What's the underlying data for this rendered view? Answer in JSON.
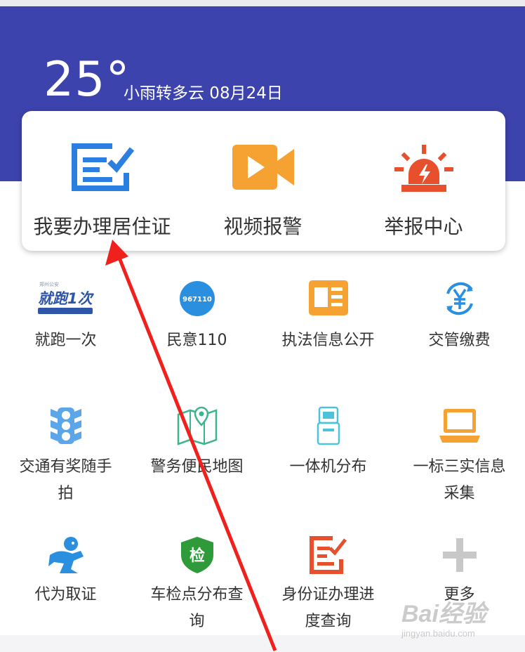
{
  "header": {
    "temperature": "25°",
    "weather": "小雨转多云 08月24日",
    "bg_color": "#3d43ad"
  },
  "quick_actions": [
    {
      "label": "我要办理居住证",
      "icon": "id-form-icon"
    },
    {
      "label": "视频报警",
      "icon": "video-camera-icon"
    },
    {
      "label": "举报中心",
      "icon": "alarm-siren-icon"
    }
  ],
  "services": [
    {
      "label": "就跑一次",
      "icon": "jiupao-logo-icon",
      "icon_text": "就跑1次"
    },
    {
      "label": "民意110",
      "icon": "hotline-icon",
      "icon_text": "967110"
    },
    {
      "label": "执法信息公开",
      "icon": "info-card-icon"
    },
    {
      "label": "交管缴费",
      "icon": "yuan-payment-icon"
    },
    {
      "label": "交通有奖随手拍",
      "icon": "traffic-light-icon"
    },
    {
      "label": "警务便民地图",
      "icon": "map-pin-icon"
    },
    {
      "label": "一体机分布",
      "icon": "kiosk-icon"
    },
    {
      "label": "一标三实信息采集",
      "icon": "laptop-icon"
    },
    {
      "label": "代为取证",
      "icon": "runner-icon"
    },
    {
      "label": "车检点分布查询",
      "icon": "inspection-shield-icon",
      "icon_text": "检"
    },
    {
      "label": "身份证办理进度查询",
      "icon": "id-progress-icon"
    },
    {
      "label": "更多",
      "icon": "plus-icon"
    }
  ],
  "watermark": {
    "main": "Bai经验",
    "sub": "jingyan.baidu.com"
  },
  "colors": {
    "blue": "#2b7fe0",
    "orange": "#f5a233",
    "red": "#e8502d",
    "green": "#2e9a3a",
    "arrow": "#f0201c"
  }
}
